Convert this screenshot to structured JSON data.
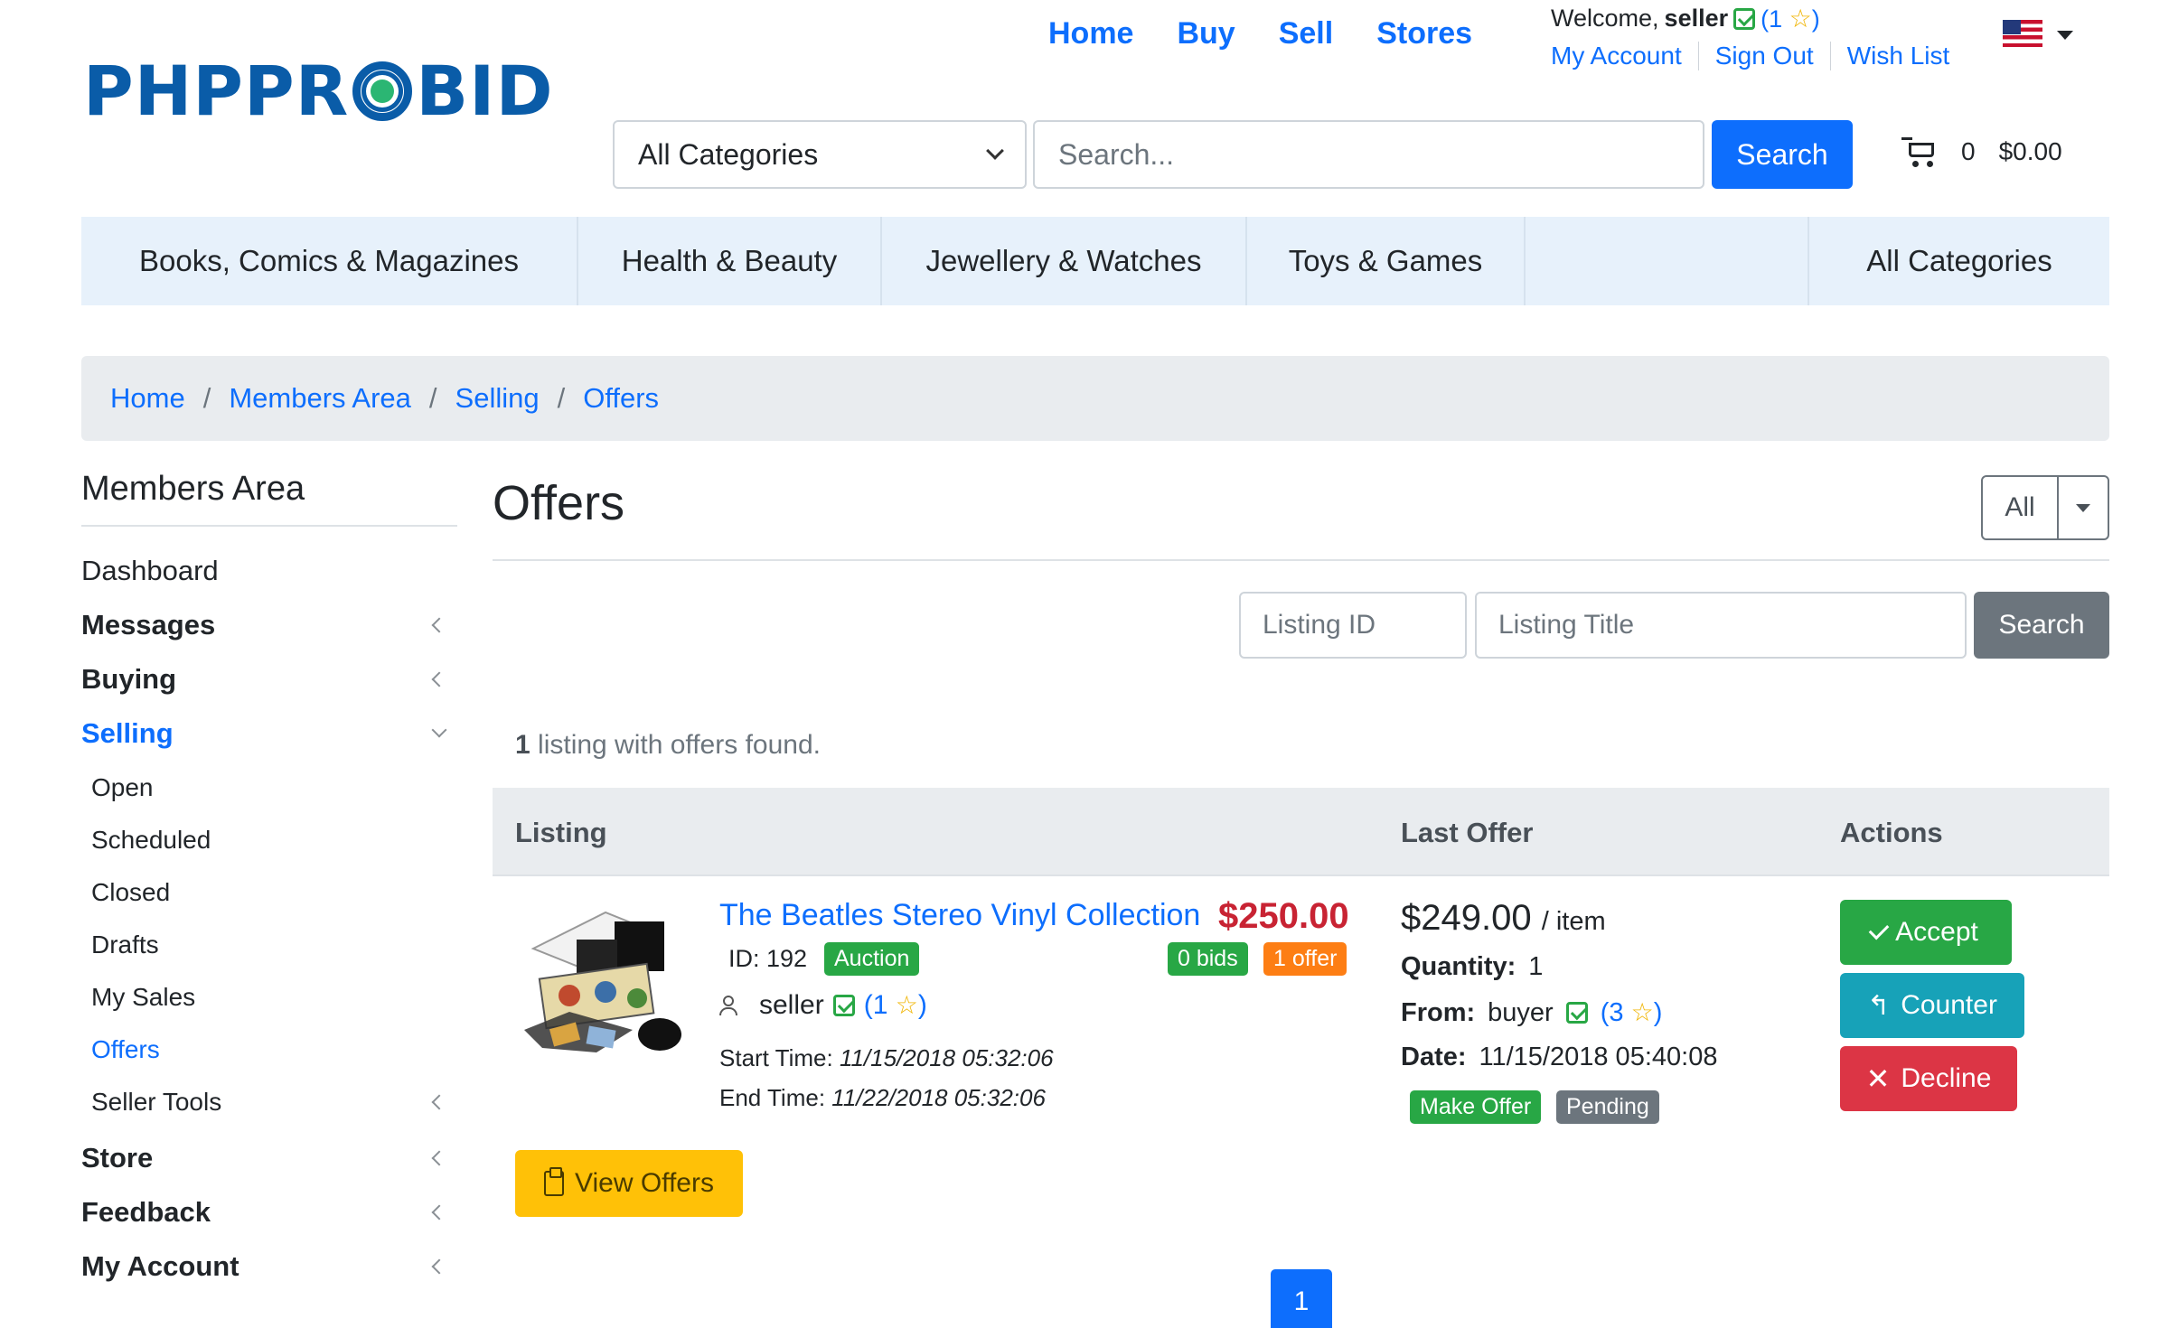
{
  "logo": {
    "text_left": "PHPPR",
    "text_right": "BID"
  },
  "topnav": [
    "Home",
    "Buy",
    "Sell",
    "Stores"
  ],
  "user": {
    "welcome": "Welcome,",
    "name": "seller",
    "rating_open": "(",
    "rating": "1",
    "rating_close": ")"
  },
  "account_links": [
    "My Account",
    "Sign Out",
    "Wish List"
  ],
  "search": {
    "category": "All Categories",
    "placeholder": "Search...",
    "button": "Search"
  },
  "cart": {
    "count": "0",
    "total": "$0.00"
  },
  "categories": [
    "Books, Comics & Magazines",
    "Health & Beauty",
    "Jewellery & Watches",
    "Toys & Games",
    "All Categories"
  ],
  "breadcrumb": [
    "Home",
    "Members Area",
    "Selling",
    "Offers"
  ],
  "sidebar": {
    "title": "Members Area",
    "items": [
      "Dashboard",
      "Messages",
      "Buying",
      "Selling",
      "Open",
      "Scheduled",
      "Closed",
      "Drafts",
      "My Sales",
      "Offers",
      "Seller Tools",
      "Store",
      "Feedback",
      "My Account"
    ]
  },
  "page": {
    "title": "Offers",
    "filter": "All",
    "listing_id_placeholder": "Listing ID",
    "listing_title_placeholder": "Listing Title",
    "search_button": "Search",
    "found_count": "1",
    "found_text": " listing with offers found."
  },
  "table": {
    "headers": [
      "Listing",
      "Last Offer",
      "Actions"
    ],
    "row": {
      "title": "The Beatles Stereo Vinyl Collection",
      "price": "$250.00",
      "id_label": "ID: 192",
      "type_badge": "Auction",
      "bids_badge": "0 bids",
      "offers_badge": "1 offer",
      "seller": "seller",
      "seller_rating": "1",
      "start_label": "Start Time:",
      "start_time": "11/15/2018 05:32:06",
      "end_label": "End Time:",
      "end_time": "11/22/2018 05:32:06",
      "view_offers": "View Offers",
      "offer_amount": "$249.00",
      "offer_unit": "/ item",
      "quantity_label": "Quantity:",
      "quantity": "1",
      "from_label": "From:",
      "from_user": "buyer",
      "from_rating": "3",
      "date_label": "Date:",
      "date": "11/15/2018 05:40:08",
      "offer_type_badge": "Make Offer",
      "status_badge": "Pending",
      "accept": "Accept",
      "counter": "Counter",
      "decline": "Decline"
    }
  },
  "pagination": {
    "current": "1"
  },
  "colors": {
    "primary": "#0d6efd",
    "success": "#28a745",
    "info": "#17a2b8",
    "danger": "#dc3545",
    "warning": "#ffc107",
    "price": "#c82333"
  }
}
